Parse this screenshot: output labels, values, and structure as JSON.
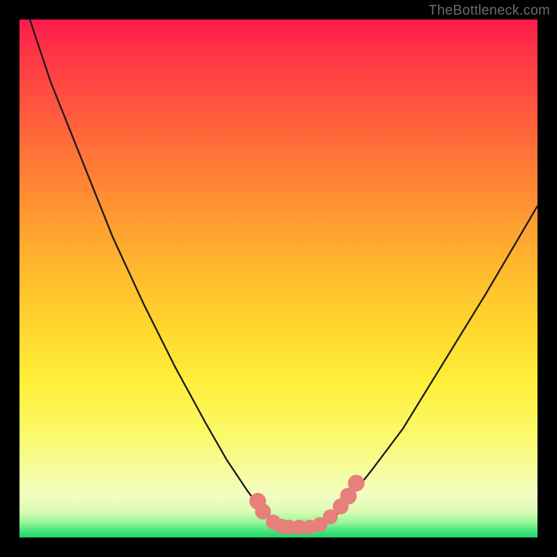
{
  "watermark": "TheBottleneck.com",
  "colors": {
    "frame": "#000000",
    "curve_stroke": "#1a1a1a",
    "marker_fill": "#e77f7a",
    "marker_stroke": "#d96b66"
  },
  "chart_data": {
    "type": "line",
    "title": "",
    "xlabel": "",
    "ylabel": "",
    "xlim": [
      0,
      100
    ],
    "ylim": [
      0,
      100
    ],
    "grid": false,
    "legend": false,
    "note": "Axes are unlabeled; values are pixel-fraction estimates (0–100) read from the rendered figure. y is inverted visually (0 at top).",
    "series": [
      {
        "name": "curve",
        "x": [
          2,
          6,
          12,
          18,
          24,
          30,
          36,
          40,
          44,
          47,
          50,
          53,
          56,
          59,
          62,
          64,
          68,
          74,
          82,
          90,
          100
        ],
        "y": [
          0,
          12,
          27,
          42,
          55,
          67,
          78,
          85,
          91,
          95,
          97,
          98,
          98,
          97,
          95,
          92,
          87,
          79,
          66,
          53,
          36
        ]
      }
    ],
    "markers": [
      {
        "x": 46,
        "y": 93,
        "r": 1.2
      },
      {
        "x": 47,
        "y": 95,
        "r": 1.1
      },
      {
        "x": 49,
        "y": 97,
        "r": 1.0
      },
      {
        "x": 50.5,
        "y": 97.8,
        "r": 1.0
      },
      {
        "x": 52,
        "y": 98,
        "r": 1.0
      },
      {
        "x": 54,
        "y": 98,
        "r": 1.0
      },
      {
        "x": 56,
        "y": 98,
        "r": 1.0
      },
      {
        "x": 58,
        "y": 97.5,
        "r": 1.0
      },
      {
        "x": 60,
        "y": 96,
        "r": 1.0
      },
      {
        "x": 62,
        "y": 94,
        "r": 1.1
      },
      {
        "x": 63.5,
        "y": 92,
        "r": 1.2
      },
      {
        "x": 65,
        "y": 89.5,
        "r": 1.2
      }
    ]
  }
}
